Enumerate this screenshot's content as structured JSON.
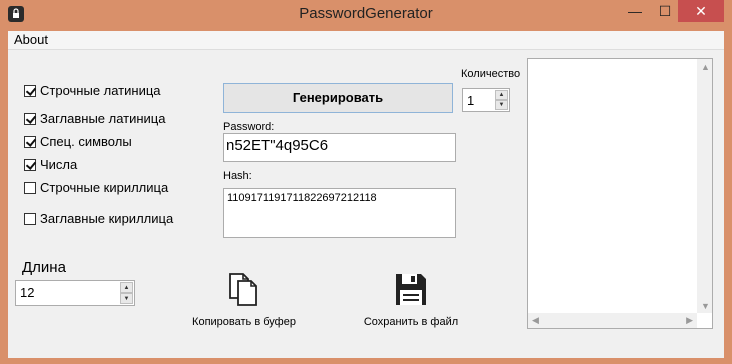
{
  "window": {
    "title": "PasswordGenerator",
    "close_glyph": "✕",
    "minimize_glyph": "—",
    "maximize_glyph": "☐"
  },
  "menu": {
    "about": "About"
  },
  "options": [
    {
      "label": "Строчные латиница",
      "checked": true
    },
    {
      "label": "Заглавные латиница",
      "checked": true
    },
    {
      "label": "Спец. символы",
      "checked": true
    },
    {
      "label": "Числа",
      "checked": true
    },
    {
      "label": "Строчные кириллица",
      "checked": false
    },
    {
      "label": "Заглавные кириллица",
      "checked": false
    }
  ],
  "generate": {
    "label": "Генерировать"
  },
  "count": {
    "label": "Количество",
    "value": "1"
  },
  "password": {
    "label": "Password:",
    "value": "n52ET\"4q95C6"
  },
  "hash": {
    "label": "Hash:",
    "value": "1109171191711822697212118"
  },
  "length": {
    "label": "Длина",
    "value": "12"
  },
  "actions": {
    "copy": "Копировать в буфер",
    "save": "Сохранить в файл"
  },
  "icons": {
    "copy": "copy-icon",
    "save": "floppy-disk-icon",
    "app": "app-icon"
  }
}
